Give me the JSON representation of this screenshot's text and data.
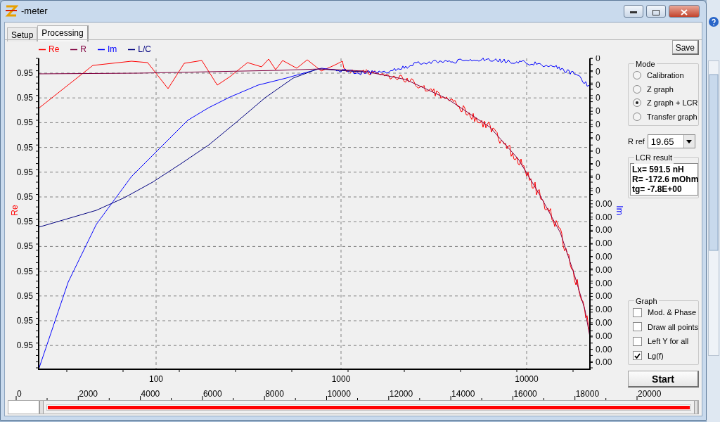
{
  "window": {
    "title": "-meter"
  },
  "tabs": [
    {
      "label": "Setup",
      "selected": false
    },
    {
      "label": "Processing",
      "selected": true
    }
  ],
  "legend": [
    {
      "label": "Re",
      "color": "#ff0000"
    },
    {
      "label": "R",
      "color": "#800040"
    },
    {
      "label": "Im",
      "color": "#0000ff"
    },
    {
      "label": "L/C",
      "color": "#000080"
    }
  ],
  "save_button": "Save",
  "plot": {
    "left_axis_title": "Re",
    "right_axis_title": "Im",
    "left_ticks": [
      "0.95",
      "0.95",
      "0.95",
      "0.95",
      "0.95",
      "0.95",
      "0.95",
      "0.95",
      "0.95",
      "0.95",
      "0.95",
      "0.95"
    ],
    "right_ticks": [
      "0",
      "0",
      "0",
      "0",
      "0",
      "0",
      "0",
      "0",
      "0",
      "0",
      "0",
      "0.00",
      "0.00",
      "0.00",
      "0.00",
      "0.00",
      "0.00",
      "0.00",
      "0.00",
      "0.00",
      "0.00",
      "0.00",
      "0.00",
      "0.00"
    ],
    "x_ticks": [
      "100",
      "1000",
      "10000"
    ]
  },
  "mode": {
    "title": "Mode",
    "options": [
      {
        "label": "Calibration",
        "selected": false
      },
      {
        "label": "Z graph",
        "selected": false
      },
      {
        "label": "Z graph + LCR",
        "selected": true
      },
      {
        "label": "Transfer graph",
        "selected": false
      }
    ]
  },
  "r_ref": {
    "label": "R ref",
    "value": "19.65"
  },
  "lcr_result": {
    "title": "LCR result",
    "lines": [
      "Lx= 591.5 nH",
      "R= -172.6 mOhm",
      "tg= -7.8E+00"
    ]
  },
  "graph": {
    "title": "Graph",
    "options": [
      {
        "label": "Mod. & Phase",
        "checked": false
      },
      {
        "label": "Draw all points",
        "checked": false
      },
      {
        "label": "Left Y for all",
        "checked": false
      },
      {
        "label": "Lg(f)",
        "checked": true
      }
    ]
  },
  "start_button": "Start",
  "range_slider": {
    "level": 1
  },
  "range_scale": {
    "ticks": [
      "0",
      "2000",
      "4000",
      "6000",
      "8000",
      "10000",
      "12000",
      "14000",
      "16000",
      "18000",
      "20000"
    ]
  }
}
